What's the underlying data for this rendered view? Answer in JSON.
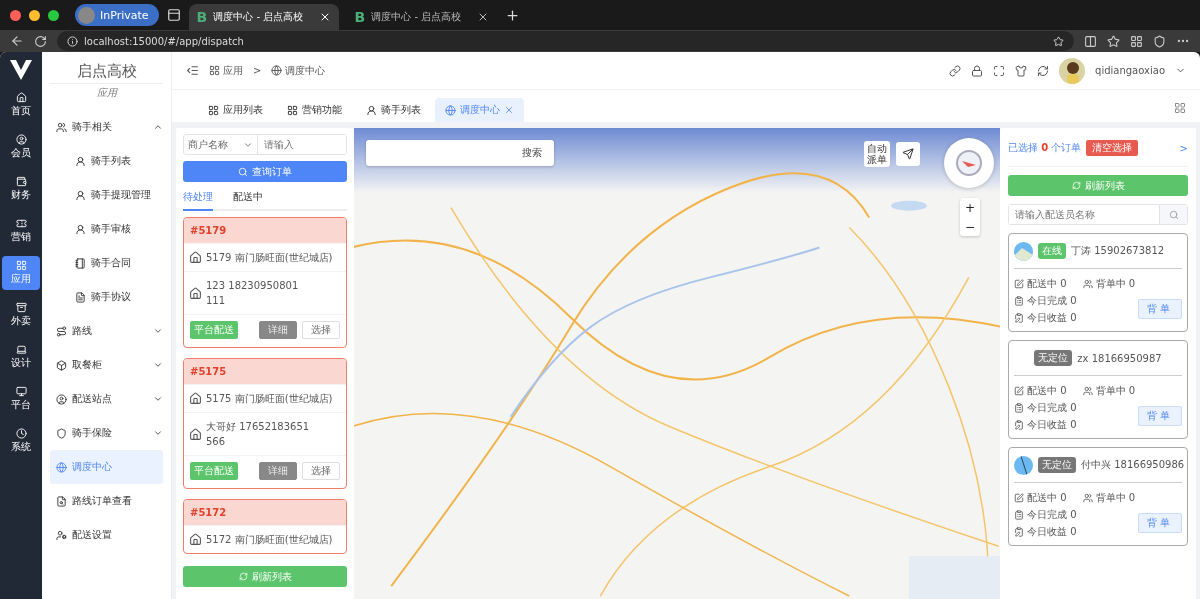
{
  "browser": {
    "profile": "InPrivate",
    "tabs": [
      {
        "icon": "B",
        "title": "调度中心 - 启点高校",
        "selected": true
      },
      {
        "icon": "B",
        "title": "调度中心 - 启点高校",
        "selected": false
      }
    ],
    "address": "localhost:15000/#/app/dispatch"
  },
  "rail": [
    {
      "label": "首页",
      "selected": false
    },
    {
      "label": "会员",
      "selected": false
    },
    {
      "label": "财务",
      "selected": false
    },
    {
      "label": "营销",
      "selected": false
    },
    {
      "label": "应用",
      "selected": true
    },
    {
      "label": "外卖",
      "selected": false
    },
    {
      "label": "设计",
      "selected": false
    },
    {
      "label": "平台",
      "selected": false
    },
    {
      "label": "系统",
      "selected": false
    }
  ],
  "sidebar": {
    "title": "启点高校",
    "subtitle": "应用",
    "items": [
      {
        "label": "骑手相关",
        "expanded": true,
        "selected": false,
        "children": [
          {
            "label": "骑手列表",
            "selected": false
          },
          {
            "label": "骑手提现管理",
            "selected": false
          },
          {
            "label": "骑手审核",
            "selected": false
          },
          {
            "label": "骑手合同",
            "selected": false
          },
          {
            "label": "骑手协议",
            "selected": false
          }
        ]
      },
      {
        "label": "路线",
        "expanded": false,
        "selected": false
      },
      {
        "label": "取餐柜",
        "expanded": false,
        "selected": false
      },
      {
        "label": "配送站点",
        "expanded": false,
        "selected": false
      },
      {
        "label": "骑手保险",
        "expanded": false,
        "selected": false
      },
      {
        "label": "调度中心",
        "selected": true
      },
      {
        "label": "路线订单查看",
        "selected": false
      },
      {
        "label": "配送设置",
        "selected": false
      }
    ]
  },
  "breadcrumb": {
    "items": [
      "应用",
      "调度中心"
    ],
    "separator": ">"
  },
  "user": {
    "name": "qidiangaoxiao"
  },
  "page_tabs": [
    {
      "label": "应用列表",
      "selected": false
    },
    {
      "label": "营销功能",
      "selected": false
    },
    {
      "label": "骑手列表",
      "selected": false
    },
    {
      "label": "调度中心",
      "selected": true
    }
  ],
  "orders": {
    "filter": {
      "select": "商户名称",
      "placeholder": "请输入"
    },
    "query_button": "查询订单",
    "tabs": [
      {
        "label": "待处理",
        "selected": true
      },
      {
        "label": "配送中",
        "selected": false
      }
    ],
    "cards": [
      {
        "id": "#5179",
        "merchant": "5179 南门肠旺面(世纪城店)",
        "customer": "123 18230950801",
        "address": "111",
        "tag": "平台配送",
        "buttons": [
          "详细",
          "选择"
        ]
      },
      {
        "id": "#5175",
        "merchant": "5175 南门肠旺面(世纪城店)",
        "customer": "大哥好 17652183651",
        "address": "566",
        "tag": "平台配送",
        "buttons": [
          "详细",
          "选择"
        ]
      },
      {
        "id": "#5172",
        "merchant": "5172 南门肠旺面(世纪城店)"
      }
    ],
    "refresh_button": "刷新列表"
  },
  "map": {
    "search_button": "搜索",
    "auto_dispatch": "自动派单",
    "zoom": [
      "+",
      "−"
    ]
  },
  "riders_panel": {
    "selected_prefix": "已选择",
    "selected_count": "0",
    "selected_suffix": "个订单",
    "clear_button": "清空选择",
    "expand": ">",
    "refresh_button": "刷新列表",
    "search_placeholder": "请输入配送员名称",
    "riders": [
      {
        "kind": "avatar",
        "status": "在线",
        "color": "#5cc46a",
        "name": "丁涛 15902673812",
        "stats": [
          "配送中 0",
          "背单中 0",
          "今日完成 0",
          "今日收益 0"
        ],
        "button": "背单"
      },
      {
        "kind": "plain",
        "status": "无定位",
        "color": "#777777",
        "name": "zx 18166950987",
        "stats": [
          "配送中 0",
          "背单中 0",
          "今日完成 0",
          "今日收益 0"
        ],
        "button": "背单"
      },
      {
        "kind": "avatar",
        "status": "无定位",
        "color": "#777777",
        "name": "付中兴 18166950986",
        "stats": [
          "配送中 0",
          "背单中 0",
          "今日完成 0",
          "今日收益 0"
        ],
        "button": "背单"
      }
    ]
  }
}
